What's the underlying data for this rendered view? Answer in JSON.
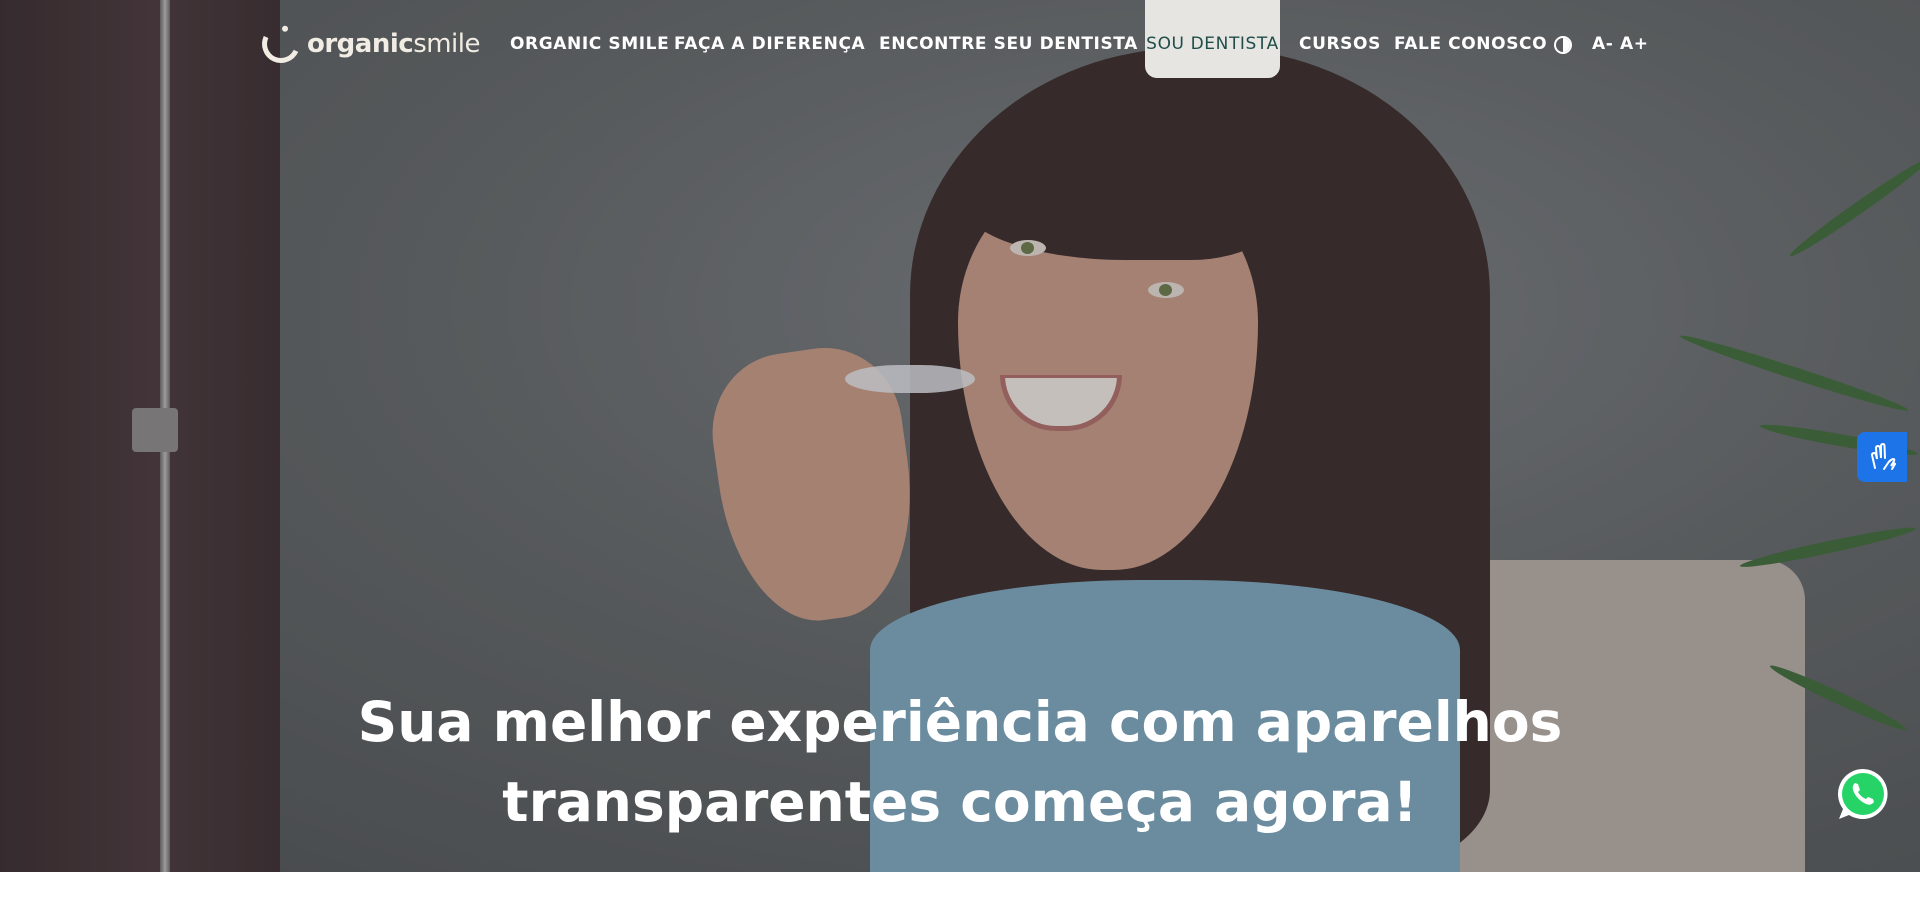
{
  "logo": {
    "text_bold": "organic",
    "text_light": "smile"
  },
  "nav": {
    "items": [
      {
        "label": "ORGANIC SMILE"
      },
      {
        "label": "FAÇA A DIFERENÇA"
      },
      {
        "label": "ENCONTRE SEU DENTISTA"
      },
      {
        "label": "SOU DENTISTA",
        "active": true
      },
      {
        "label": "CURSOS"
      },
      {
        "label": "FALE CONOSCO"
      }
    ],
    "font_decrease": "A-",
    "font_increase": "A+",
    "contrast_icon": "contrast-icon"
  },
  "hero": {
    "headline_line1": "Sua melhor experiência com aparelhos",
    "headline_line2": "transparentes começa agora!"
  },
  "floating": {
    "libras_icon": "sign-language-hands-icon",
    "whatsapp_icon": "whatsapp-icon"
  },
  "colors": {
    "nav_active_bg": "#e7e5e2",
    "nav_active_text": "#1f4d4a",
    "libras_blue": "#1d74e8",
    "whatsapp_green": "#25d366"
  }
}
